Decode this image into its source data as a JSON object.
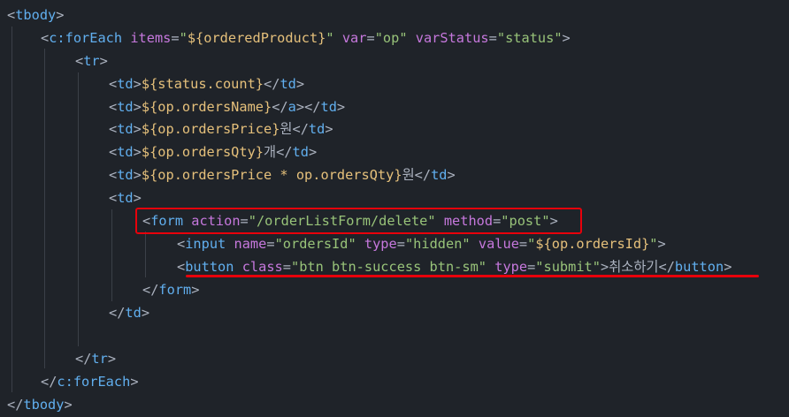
{
  "theme": {
    "background": "#1f2329",
    "punctuation": "#abb2bf",
    "tag": "#61afef",
    "attribute": "#c678dd",
    "string": "#98c379",
    "expression": "#e5c07b",
    "annotation": "#e8000b"
  },
  "code_lines": [
    {
      "tokens": [
        {
          "t": "punct",
          "v": "<"
        },
        {
          "t": "tag",
          "v": "tbody"
        },
        {
          "t": "punct",
          "v": ">"
        }
      ]
    },
    {
      "tokens": [
        {
          "t": "punct",
          "v": "<"
        },
        {
          "t": "tag",
          "v": "c:forEach"
        },
        {
          "t": "punct",
          "v": " "
        },
        {
          "t": "attr",
          "v": "items"
        },
        {
          "t": "punct",
          "v": "="
        },
        {
          "t": "str",
          "v": "\""
        },
        {
          "t": "expr",
          "v": "${orderedProduct}"
        },
        {
          "t": "str",
          "v": "\""
        },
        {
          "t": "punct",
          "v": " "
        },
        {
          "t": "attr",
          "v": "var"
        },
        {
          "t": "punct",
          "v": "="
        },
        {
          "t": "str",
          "v": "\"op\""
        },
        {
          "t": "punct",
          "v": " "
        },
        {
          "t": "attr",
          "v": "varStatus"
        },
        {
          "t": "punct",
          "v": "="
        },
        {
          "t": "str",
          "v": "\"status\""
        },
        {
          "t": "punct",
          "v": ">"
        }
      ]
    },
    {
      "tokens": [
        {
          "t": "punct",
          "v": "<"
        },
        {
          "t": "tag",
          "v": "tr"
        },
        {
          "t": "punct",
          "v": ">"
        }
      ]
    },
    {
      "tokens": [
        {
          "t": "punct",
          "v": "<"
        },
        {
          "t": "tag",
          "v": "td"
        },
        {
          "t": "punct",
          "v": ">"
        },
        {
          "t": "expr",
          "v": "${status.count}"
        },
        {
          "t": "punct",
          "v": "</"
        },
        {
          "t": "tag",
          "v": "td"
        },
        {
          "t": "punct",
          "v": ">"
        }
      ]
    },
    {
      "tokens": [
        {
          "t": "punct",
          "v": "<"
        },
        {
          "t": "tag",
          "v": "td"
        },
        {
          "t": "punct",
          "v": ">"
        },
        {
          "t": "expr",
          "v": "${op.ordersName}"
        },
        {
          "t": "punct",
          "v": "</"
        },
        {
          "t": "tag",
          "v": "a"
        },
        {
          "t": "punct",
          "v": "></"
        },
        {
          "t": "tag",
          "v": "td"
        },
        {
          "t": "punct",
          "v": ">"
        }
      ]
    },
    {
      "tokens": [
        {
          "t": "punct",
          "v": "<"
        },
        {
          "t": "tag",
          "v": "td"
        },
        {
          "t": "punct",
          "v": ">"
        },
        {
          "t": "expr",
          "v": "${op.ordersPrice}"
        },
        {
          "t": "text",
          "v": "원"
        },
        {
          "t": "punct",
          "v": "</"
        },
        {
          "t": "tag",
          "v": "td"
        },
        {
          "t": "punct",
          "v": ">"
        }
      ]
    },
    {
      "tokens": [
        {
          "t": "punct",
          "v": "<"
        },
        {
          "t": "tag",
          "v": "td"
        },
        {
          "t": "punct",
          "v": ">"
        },
        {
          "t": "expr",
          "v": "${op.ordersQty}"
        },
        {
          "t": "text",
          "v": "개"
        },
        {
          "t": "punct",
          "v": "</"
        },
        {
          "t": "tag",
          "v": "td"
        },
        {
          "t": "punct",
          "v": ">"
        }
      ]
    },
    {
      "tokens": [
        {
          "t": "punct",
          "v": "<"
        },
        {
          "t": "tag",
          "v": "td"
        },
        {
          "t": "punct",
          "v": ">"
        },
        {
          "t": "expr",
          "v": "${op.ordersPrice * op.ordersQty}"
        },
        {
          "t": "text",
          "v": "원"
        },
        {
          "t": "punct",
          "v": "</"
        },
        {
          "t": "tag",
          "v": "td"
        },
        {
          "t": "punct",
          "v": ">"
        }
      ]
    },
    {
      "tokens": [
        {
          "t": "punct",
          "v": "<"
        },
        {
          "t": "tag",
          "v": "td"
        },
        {
          "t": "punct",
          "v": ">"
        }
      ]
    },
    {
      "tokens": [
        {
          "t": "punct",
          "v": "<"
        },
        {
          "t": "tag",
          "v": "form"
        },
        {
          "t": "punct",
          "v": " "
        },
        {
          "t": "attr",
          "v": "action"
        },
        {
          "t": "punct",
          "v": "="
        },
        {
          "t": "str",
          "v": "\"/orderListForm/delete\""
        },
        {
          "t": "punct",
          "v": " "
        },
        {
          "t": "attr",
          "v": "method"
        },
        {
          "t": "punct",
          "v": "="
        },
        {
          "t": "str",
          "v": "\"post\""
        },
        {
          "t": "punct",
          "v": ">"
        }
      ]
    },
    {
      "tokens": [
        {
          "t": "punct",
          "v": "<"
        },
        {
          "t": "tag",
          "v": "input"
        },
        {
          "t": "punct",
          "v": " "
        },
        {
          "t": "attr",
          "v": "name"
        },
        {
          "t": "punct",
          "v": "="
        },
        {
          "t": "str",
          "v": "\"ordersId\""
        },
        {
          "t": "punct",
          "v": " "
        },
        {
          "t": "attr",
          "v": "type"
        },
        {
          "t": "punct",
          "v": "="
        },
        {
          "t": "str",
          "v": "\"hidden\""
        },
        {
          "t": "punct",
          "v": " "
        },
        {
          "t": "attr",
          "v": "value"
        },
        {
          "t": "punct",
          "v": "="
        },
        {
          "t": "str",
          "v": "\""
        },
        {
          "t": "expr",
          "v": "${op.ordersId}"
        },
        {
          "t": "str",
          "v": "\""
        },
        {
          "t": "punct",
          "v": ">"
        }
      ]
    },
    {
      "tokens": [
        {
          "t": "punct",
          "v": "<"
        },
        {
          "t": "tag",
          "v": "button"
        },
        {
          "t": "punct",
          "v": " "
        },
        {
          "t": "attr",
          "v": "class"
        },
        {
          "t": "punct",
          "v": "="
        },
        {
          "t": "str",
          "v": "\"btn btn-success btn-sm\""
        },
        {
          "t": "punct",
          "v": " "
        },
        {
          "t": "attr",
          "v": "type"
        },
        {
          "t": "punct",
          "v": "="
        },
        {
          "t": "str",
          "v": "\"submit\""
        },
        {
          "t": "punct",
          "v": ">"
        },
        {
          "t": "text",
          "v": "취소하기"
        },
        {
          "t": "punct",
          "v": "</"
        },
        {
          "t": "tag",
          "v": "button"
        },
        {
          "t": "punct",
          "v": ">"
        }
      ]
    },
    {
      "tokens": [
        {
          "t": "punct",
          "v": "</"
        },
        {
          "t": "tag",
          "v": "form"
        },
        {
          "t": "punct",
          "v": ">"
        }
      ]
    },
    {
      "tokens": [
        {
          "t": "punct",
          "v": "</"
        },
        {
          "t": "tag",
          "v": "td"
        },
        {
          "t": "punct",
          "v": ">"
        }
      ]
    },
    {
      "tokens": []
    },
    {
      "tokens": [
        {
          "t": "punct",
          "v": "</"
        },
        {
          "t": "tag",
          "v": "tr"
        },
        {
          "t": "punct",
          "v": ">"
        }
      ]
    },
    {
      "tokens": [
        {
          "t": "punct",
          "v": "</"
        },
        {
          "t": "tag",
          "v": "c:forEach"
        },
        {
          "t": "punct",
          "v": ">"
        }
      ]
    },
    {
      "tokens": [
        {
          "t": "punct",
          "v": "</"
        },
        {
          "t": "tag",
          "v": "tbody"
        },
        {
          "t": "punct",
          "v": ">"
        }
      ]
    }
  ]
}
